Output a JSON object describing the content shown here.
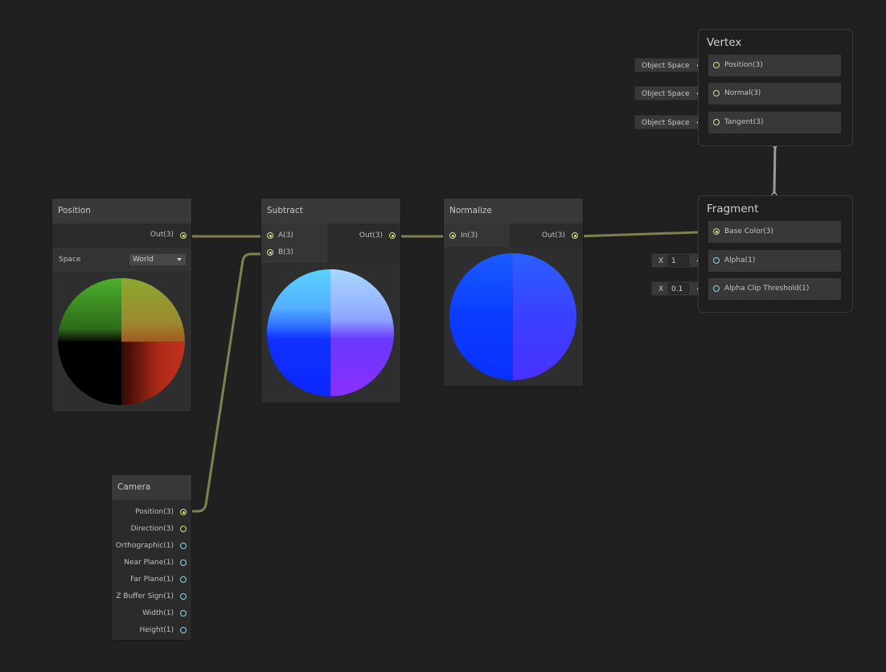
{
  "colors": {
    "background": "#202020",
    "wire_vector3": "#7f8150",
    "wire_vector1": "#4f8a8a",
    "port_vector3": "#d9e08a",
    "port_vector1": "#8ad8e0"
  },
  "position_node": {
    "title": "Position",
    "output": "Out(3)",
    "space_label": "Space",
    "space_value": "World"
  },
  "subtract_node": {
    "title": "Subtract",
    "inputs": [
      "A(3)",
      "B(3)"
    ],
    "output": "Out(3)"
  },
  "normalize_node": {
    "title": "Normalize",
    "input": "In(3)",
    "output": "Out(3)"
  },
  "camera_node": {
    "title": "Camera",
    "outputs": [
      "Position(3)",
      "Direction(3)",
      "Orthographic(1)",
      "Near Plane(1)",
      "Far Plane(1)",
      "Z Buffer Sign(1)",
      "Width(1)",
      "Height(1)"
    ]
  },
  "vertex": {
    "title": "Vertex",
    "slots": [
      {
        "label": "Position(3)",
        "input": "Object Space"
      },
      {
        "label": "Normal(3)",
        "input": "Object Space"
      },
      {
        "label": "Tangent(3)",
        "input": "Object Space"
      }
    ]
  },
  "fragment": {
    "title": "Fragment",
    "slots": [
      {
        "label": "Base Color(3)"
      },
      {
        "label": "Alpha(1)",
        "field_label": "X",
        "value": "1"
      },
      {
        "label": "Alpha Clip Threshold(1)",
        "field_label": "X",
        "value": "0.1"
      }
    ]
  }
}
